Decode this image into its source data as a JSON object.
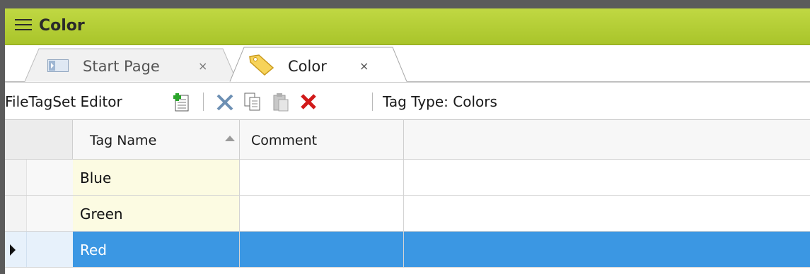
{
  "window": {
    "title": "Color"
  },
  "tabs": [
    {
      "label": "Start Page",
      "close": "×",
      "active": false
    },
    {
      "label": "Color",
      "close": "×",
      "active": true
    }
  ],
  "toolbar": {
    "editor_label": "FileTagSet Editor",
    "tag_type_label": "Tag Type: Colors",
    "buttons": [
      "add-icon",
      "cut-icon",
      "copy-icon",
      "paste-icon",
      "delete-icon"
    ]
  },
  "grid": {
    "columns": [
      "Tag Name",
      "Comment"
    ],
    "sorted_column": "Tag Name",
    "sort_direction": "ascending",
    "rows": [
      {
        "name": "Blue",
        "comment": ""
      },
      {
        "name": "Green",
        "comment": ""
      },
      {
        "name": "Red",
        "comment": "",
        "selected": true
      }
    ]
  },
  "colors": {
    "title_bar": "#b4cd33",
    "selection": "#3b97e3",
    "name_cell_bg": "#fcfbe2"
  }
}
